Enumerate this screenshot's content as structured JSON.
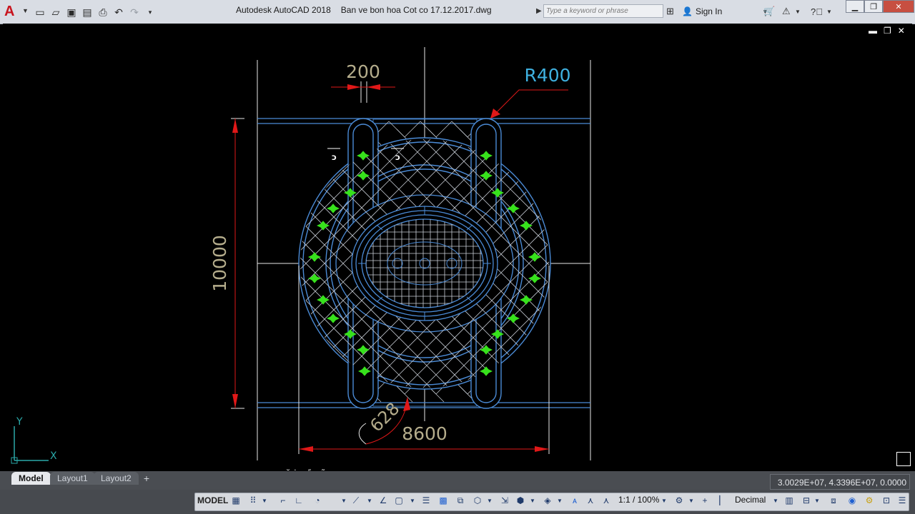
{
  "app": {
    "name": "Autodesk AutoCAD 2018",
    "document": "Ban ve bon hoa Cot co 17.12.2017.dwg",
    "logo_letter": "A"
  },
  "search": {
    "placeholder": "Type a keyword or phrase"
  },
  "account": {
    "sign_in": "Sign In"
  },
  "drawing": {
    "dimensions": {
      "width_top": "200",
      "radius": "R400",
      "height": "10000",
      "width_bottom": "8600",
      "arc_length": "628"
    },
    "colors": {
      "outline": "#4b8bd6",
      "grid": "#c9ced6",
      "hatch": "#bfc4cc",
      "dimension_text": "#b5ad8c",
      "leader": "#e01818",
      "plant": "#37e21c",
      "radius_text": "#3fb1e0",
      "construction": "#e8e8e8"
    },
    "ucs": {
      "x_label": "X",
      "y_label": "Y"
    }
  },
  "tabs": [
    {
      "label": "Model",
      "active": true
    },
    {
      "label": "Layout1",
      "active": false
    },
    {
      "label": "Layout2",
      "active": false
    }
  ],
  "coordinates": "3.0029E+07, 4.3396E+07, 0.0000",
  "status": {
    "model_label": "MODEL",
    "annotation_scale": "1:1 / 100%",
    "units": "Decimal"
  },
  "icons": {
    "qat": [
      "new-icon",
      "open-icon",
      "save-icon",
      "save-as-icon",
      "print-icon",
      "undo-icon",
      "redo-icon"
    ],
    "title_tools": [
      "binoculars-icon",
      "user-icon",
      "cart-icon",
      "exchange-icon",
      "help-icon"
    ]
  }
}
